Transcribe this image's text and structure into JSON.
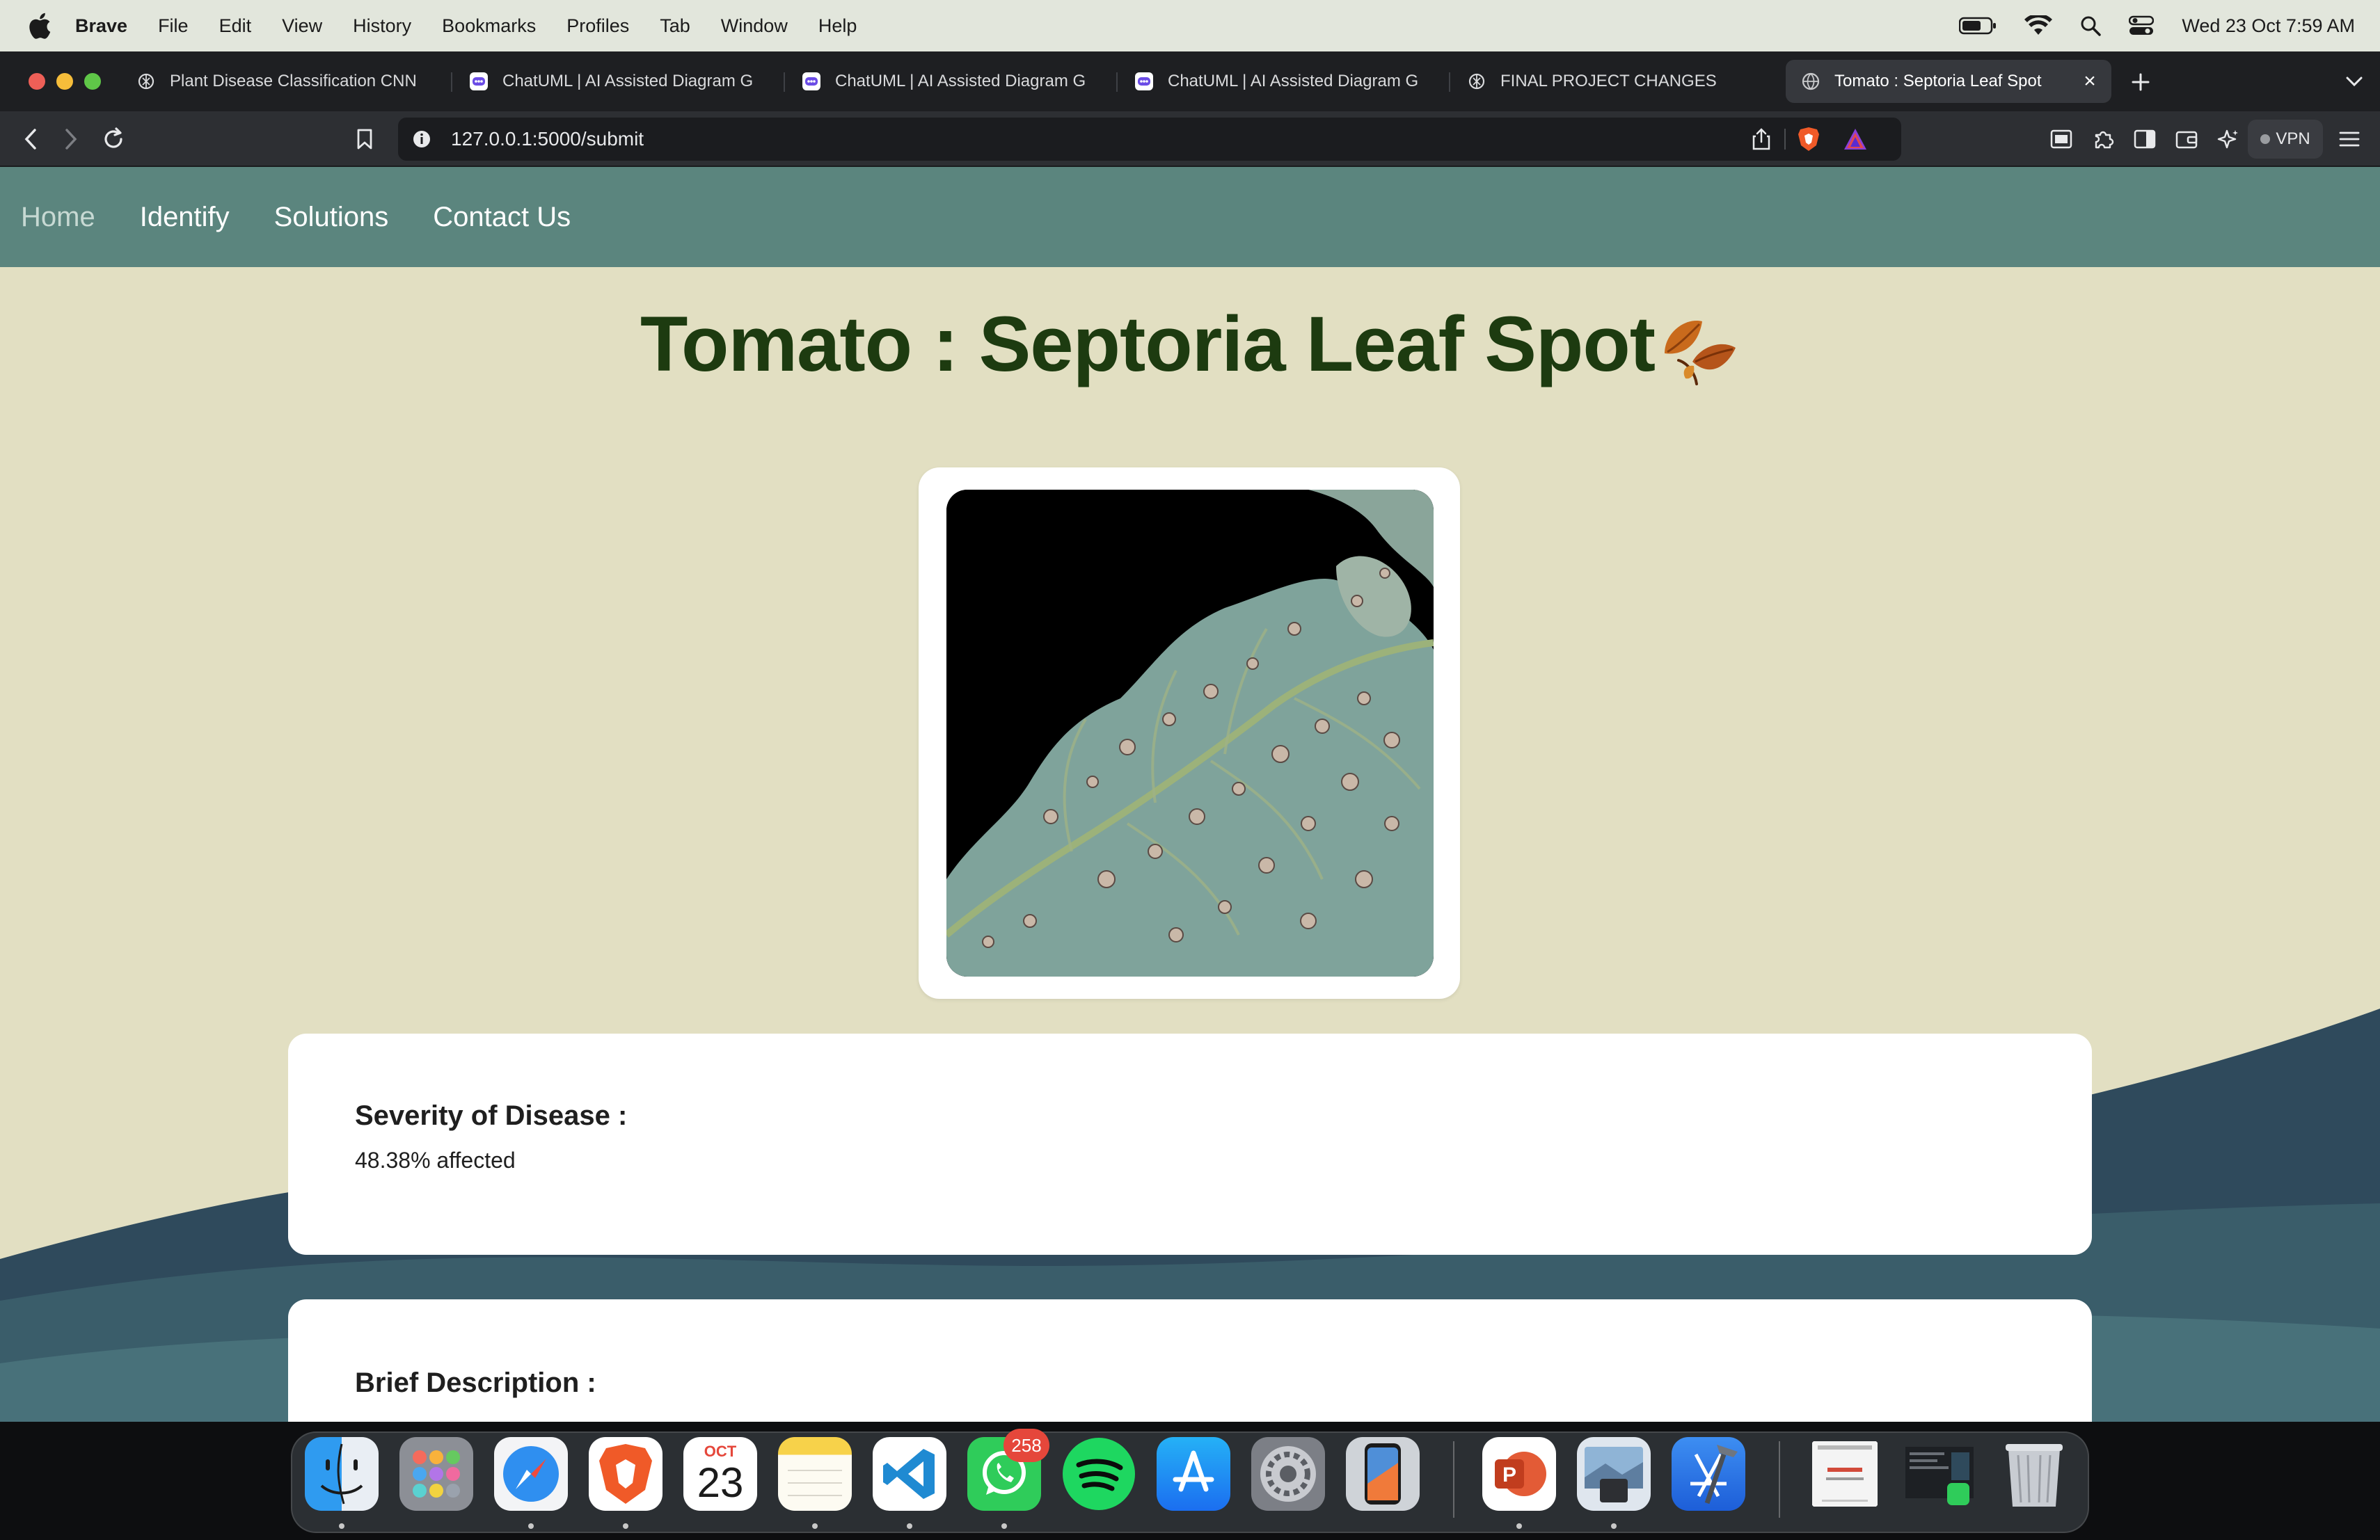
{
  "menubar": {
    "app_name": "Brave",
    "items": [
      "File",
      "Edit",
      "View",
      "History",
      "Bookmarks",
      "Profiles",
      "Tab",
      "Window",
      "Help"
    ],
    "datetime": "Wed 23 Oct  7:59 AM"
  },
  "tabs": [
    {
      "title": "Plant Disease Classification CNN",
      "icon": "chatgpt-icon"
    },
    {
      "title": "ChatUML | AI Assisted Diagram G",
      "icon": "chatuml-icon"
    },
    {
      "title": "ChatUML | AI Assisted Diagram G",
      "icon": "chatuml-icon"
    },
    {
      "title": "ChatUML | AI Assisted Diagram G",
      "icon": "chatuml-icon"
    },
    {
      "title": "FINAL PROJECT CHANGES",
      "icon": "chatgpt-icon"
    },
    {
      "title": "Tomato : Septoria Leaf Spot",
      "icon": "globe-icon",
      "active": true
    }
  ],
  "toolbar": {
    "url": "127.0.0.1:5000/submit",
    "vpn_label": "VPN"
  },
  "page": {
    "nav": [
      "Home",
      "Identify",
      "Solutions",
      "Contact Us"
    ],
    "title": "Tomato : Septoria Leaf Spot",
    "severity": {
      "heading": "Severity of Disease :",
      "value": "48.38% affected"
    },
    "description": {
      "heading": "Brief Description :"
    }
  },
  "dock": {
    "apps": [
      "Finder",
      "Launchpad",
      "Safari",
      "Brave",
      "Calendar",
      "Notes",
      "Visual Studio Code",
      "WhatsApp",
      "Spotify",
      "App Store",
      "System Settings",
      "iPhone Mirroring",
      "PowerPoint",
      "Preview",
      "Xcode",
      "Document",
      "Screenshot",
      "Trash"
    ],
    "calendar_month": "OCT",
    "calendar_day": "23",
    "whatsapp_badge": "258"
  },
  "colors": {
    "nav_bg": "#5b857e",
    "page_bg": "#e2dfc2",
    "title": "#1d3b10",
    "wave_dark": "#2f4a5c"
  }
}
